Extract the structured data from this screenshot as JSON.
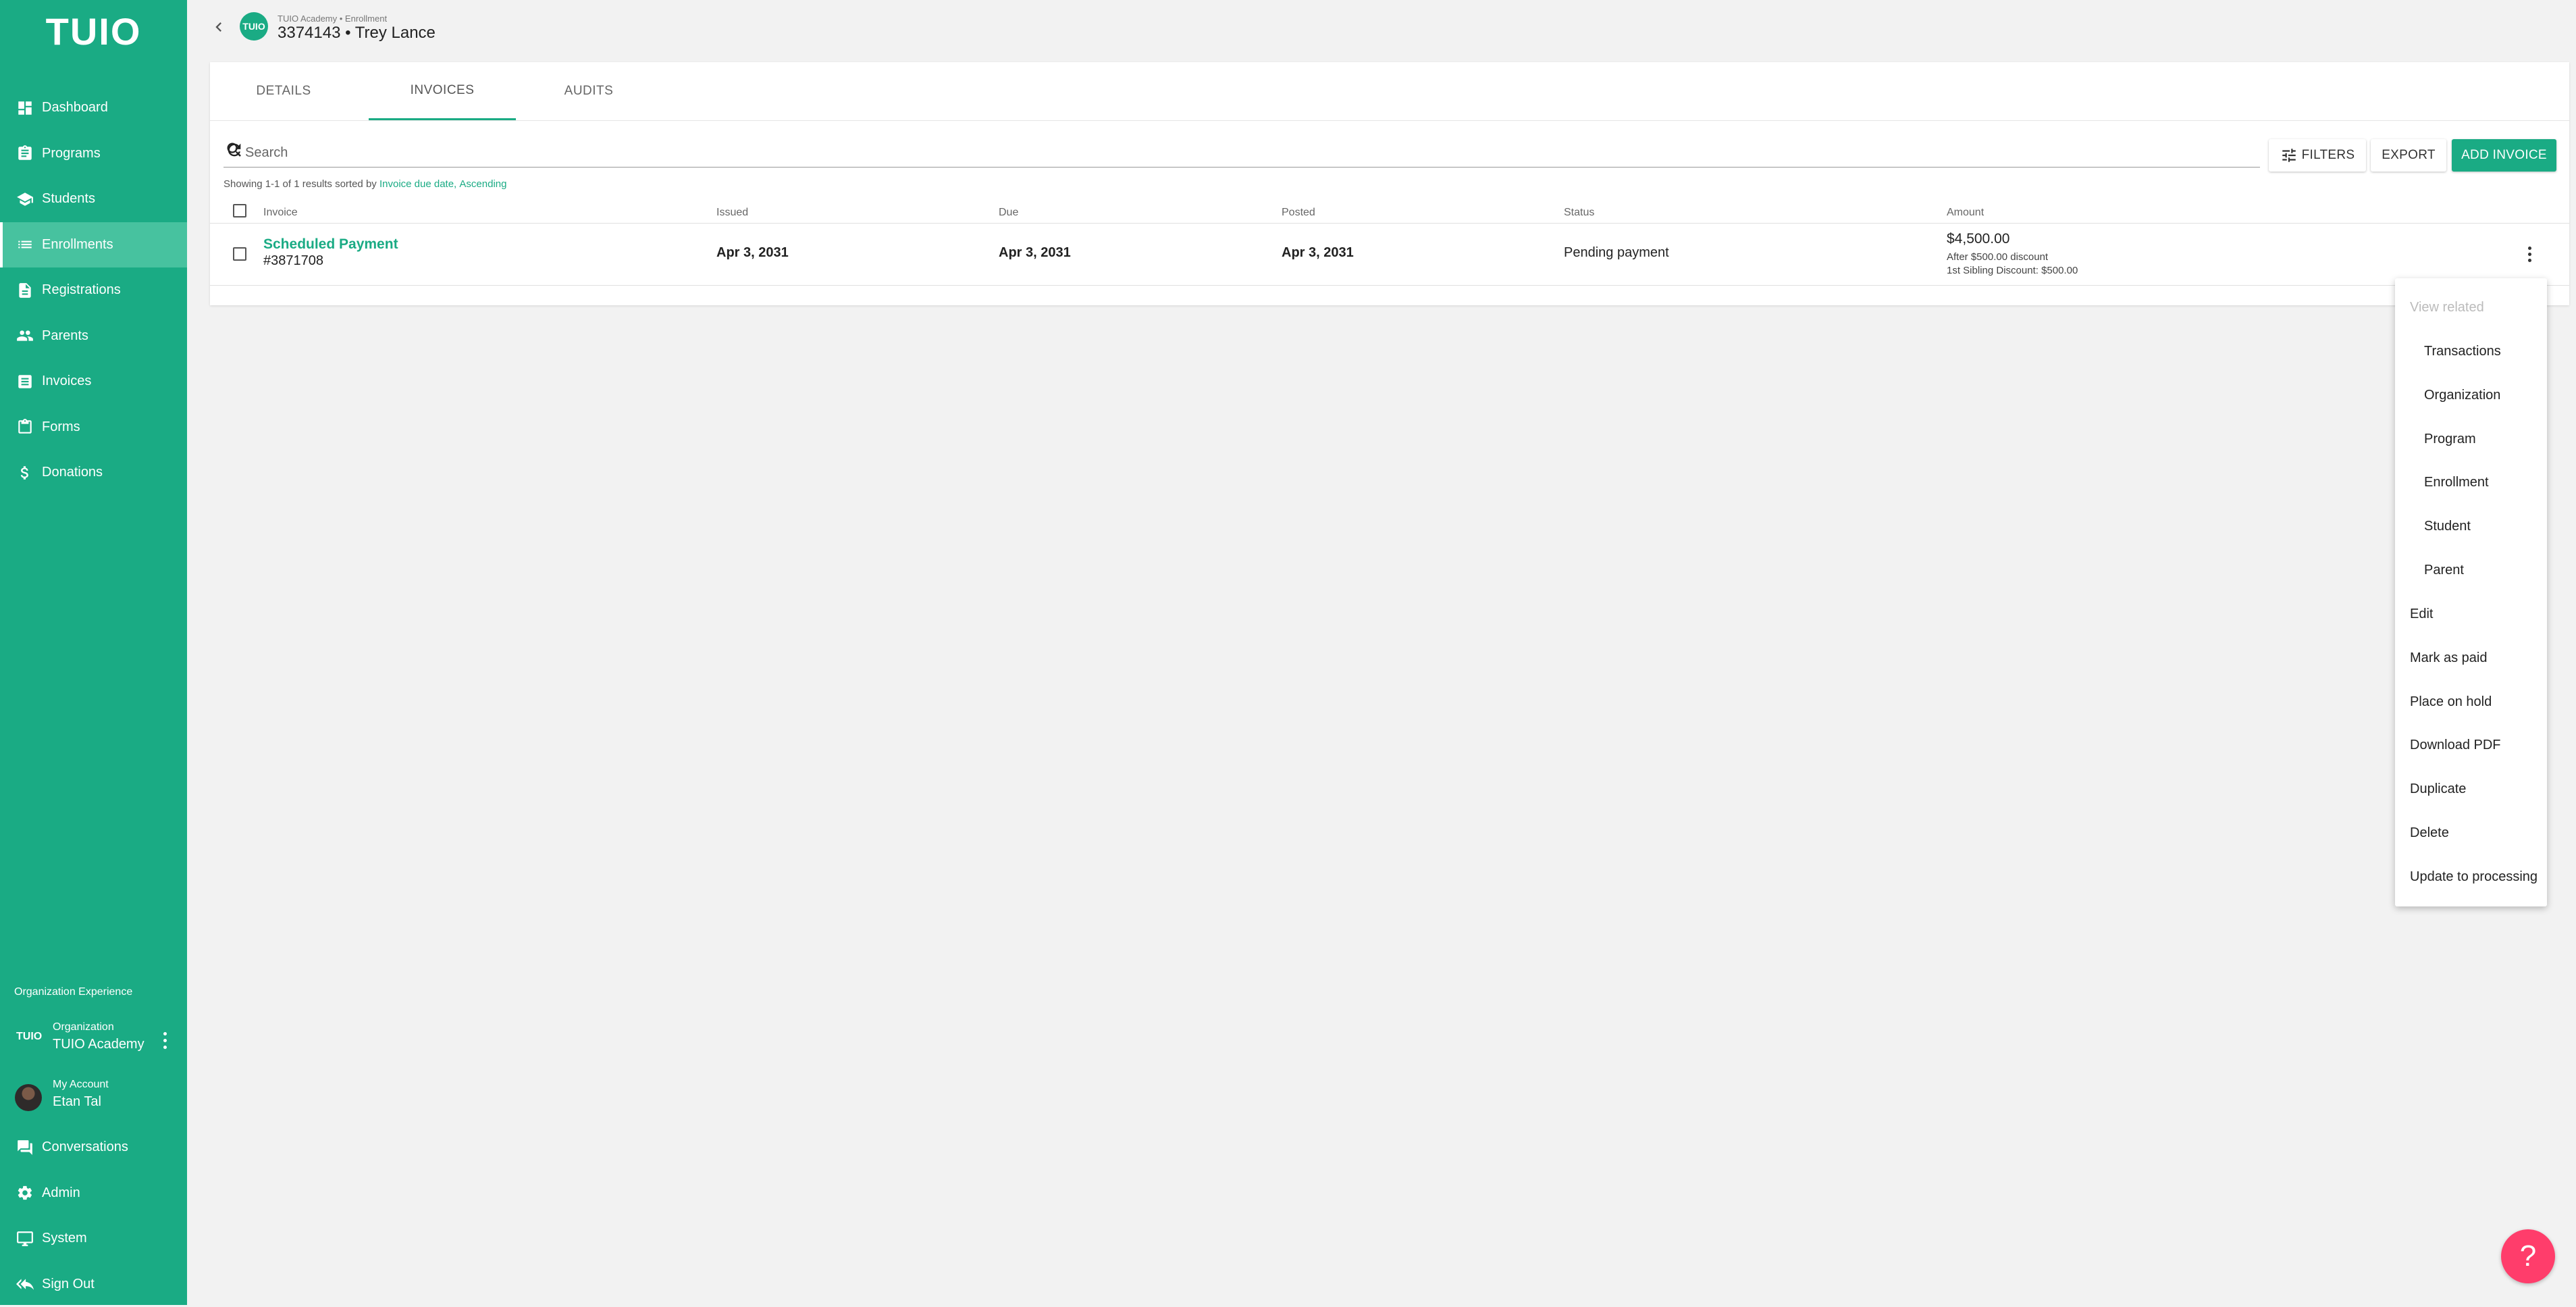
{
  "sidebar": {
    "logo": "TUIO",
    "items": [
      {
        "label": "Dashboard",
        "icon": "dashboard-icon"
      },
      {
        "label": "Programs",
        "icon": "clipboard-icon"
      },
      {
        "label": "Students",
        "icon": "graduation-cap-icon"
      },
      {
        "label": "Enrollments",
        "icon": "list-icon",
        "active": true
      },
      {
        "label": "Registrations",
        "icon": "document-icon"
      },
      {
        "label": "Parents",
        "icon": "people-icon"
      },
      {
        "label": "Invoices",
        "icon": "invoice-icon"
      },
      {
        "label": "Forms",
        "icon": "form-icon"
      },
      {
        "label": "Donations",
        "icon": "dollar-icon"
      }
    ],
    "org_experience": "Organization Experience",
    "organization": {
      "logo": "TUIO",
      "label": "Organization",
      "value": "TUIO Academy"
    },
    "account": {
      "label": "My Account",
      "value": "Etan Tal"
    },
    "bottom_items": [
      {
        "label": "Conversations",
        "icon": "chat-icon"
      },
      {
        "label": "Admin",
        "icon": "gear-icon"
      },
      {
        "label": "System",
        "icon": "monitor-icon"
      },
      {
        "label": "Sign Out",
        "icon": "sign-out-icon"
      }
    ]
  },
  "header": {
    "avatar_text": "TUIO",
    "breadcrumb": "TUIO Academy • Enrollment",
    "title": "3374143 • Trey Lance"
  },
  "tabs": [
    {
      "label": "DETAILS"
    },
    {
      "label": "INVOICES",
      "active": true
    },
    {
      "label": "AUDITS"
    }
  ],
  "search": {
    "placeholder": "Search",
    "value": ""
  },
  "toolbar": {
    "filters_label": "FILTERS",
    "export_label": "EXPORT",
    "add_label": "ADD INVOICE"
  },
  "results": {
    "prefix": "Showing 1-1 of 1 results sorted by ",
    "sort_field": "Invoice due date,",
    "sort_dir": "Ascending"
  },
  "table": {
    "columns": [
      "Invoice",
      "Issued",
      "Due",
      "Posted",
      "Status",
      "Amount"
    ],
    "rows": [
      {
        "invoice_name": "Scheduled Payment",
        "invoice_number": "#3871708",
        "issued": "Apr 3, 2031",
        "due": "Apr 3, 2031",
        "posted": "Apr 3, 2031",
        "status": "Pending payment",
        "amount": "$4,500.00",
        "amount_note1": "After $500.00 discount",
        "amount_note2": "1st Sibling Discount: $500.00"
      }
    ]
  },
  "menu": {
    "header": "View related",
    "related": [
      "Transactions",
      "Organization",
      "Program",
      "Enrollment",
      "Student",
      "Parent"
    ],
    "actions": [
      "Edit",
      "Mark as paid",
      "Place on hold",
      "Download PDF",
      "Duplicate",
      "Delete",
      "Update to processing"
    ]
  },
  "help": {
    "label": "?"
  },
  "colors": {
    "brand": "#1aab84",
    "help": "#ff3d6b"
  }
}
